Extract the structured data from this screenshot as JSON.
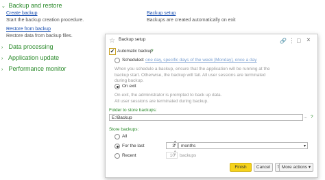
{
  "background": {
    "backup_section": {
      "title": "Backup and restore",
      "create_backup_link": "Create backup",
      "create_backup_desc": "Start the backup creation procedure.",
      "backup_setup_link": "Backup setup",
      "backup_setup_desc": "Backups are created automatically on exit",
      "restore_link": "Restore from backup",
      "restore_desc": "Restore data from backup files."
    },
    "sections": [
      {
        "title": "Data processing"
      },
      {
        "title": "Application update"
      },
      {
        "title": "Performance monitor"
      }
    ]
  },
  "dialog": {
    "title": "Backup setup",
    "help_icon": "?",
    "automatic_backup": {
      "label": "Automatic backup",
      "help": "?",
      "checked": true
    },
    "scheduled": {
      "label": "Scheduled:",
      "schedule_link": "one day, specific days of the week [Monday], once a day",
      "note": "When you schedule a backup, ensure that the application will be running at the backup start. Otherwise, the backup will fail. All user sessions are terminated during backup."
    },
    "on_exit": {
      "label": "On exit",
      "note": "On exit, the administrator is prompted to back up data. All user sessions are terminated during backup."
    },
    "folder": {
      "label": "Folder to store backups:",
      "value": "E:\\Backup",
      "browse": "...",
      "help": "?"
    },
    "store_backups": {
      "label": "Store backups:",
      "all_label": "All",
      "for_last_label": "For the last",
      "for_last_value": "3",
      "period_unit": "months",
      "recent_label": "Recent",
      "recent_value": "10",
      "recent_unit": "backups"
    },
    "buttons": {
      "finish": "Finish",
      "cancel": "Cancel",
      "help": "?",
      "more_actions": "More actions"
    }
  },
  "colors": {
    "accent_green": "#2a8a2a",
    "finish_yellow": "#f6d31c",
    "link_blue": "#1a4fb0"
  }
}
